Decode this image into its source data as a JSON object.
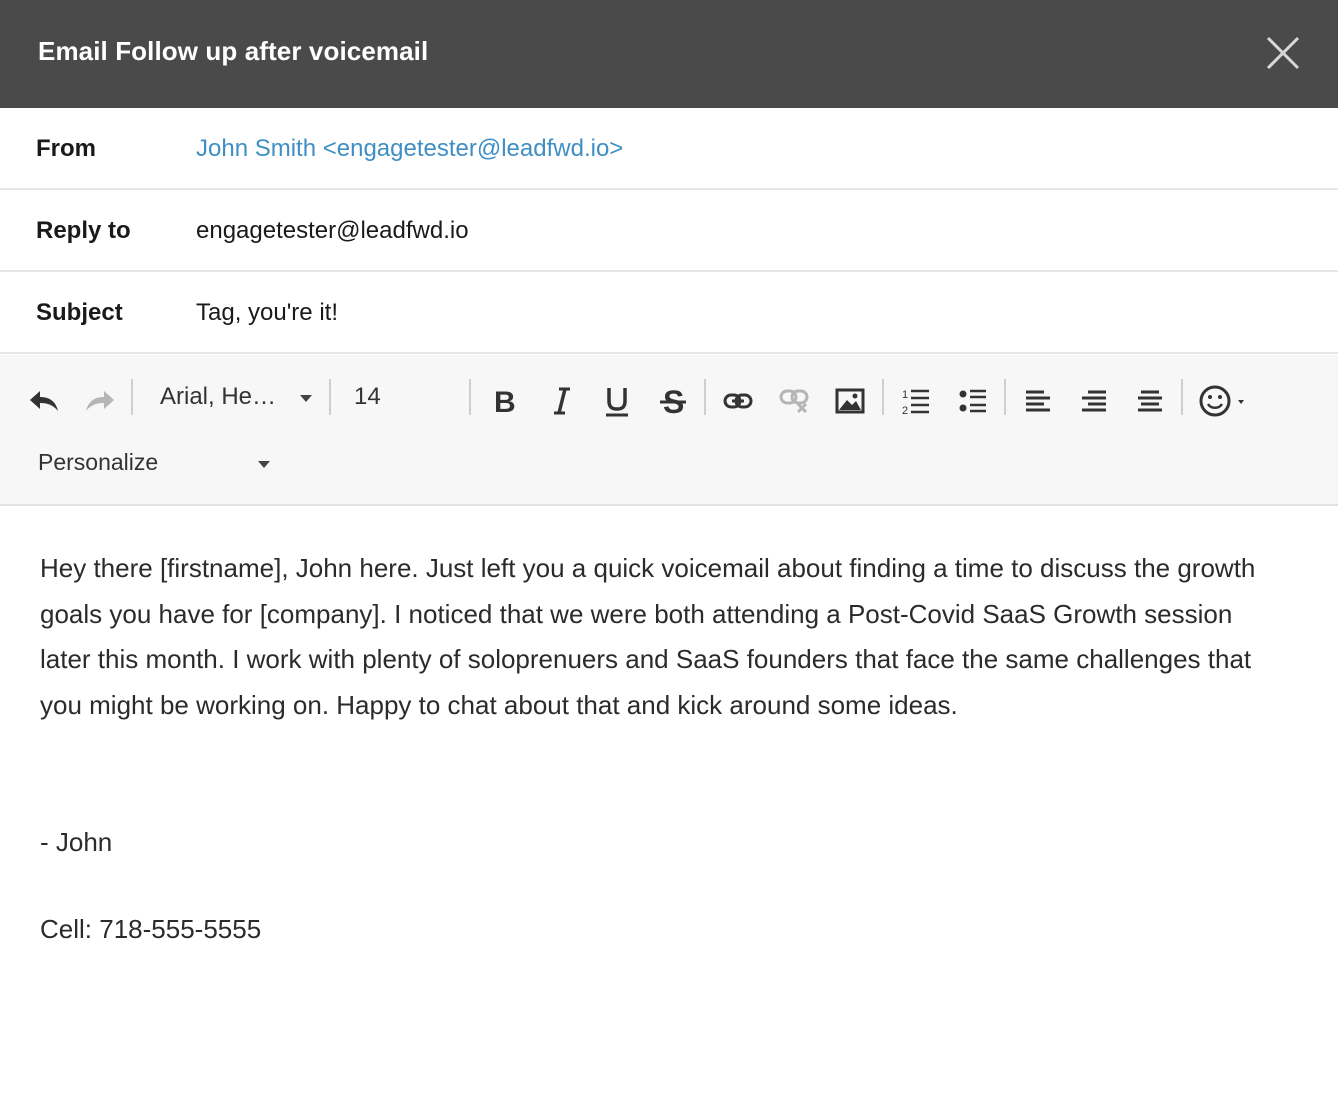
{
  "dialog": {
    "title": "Email Follow up after voicemail"
  },
  "fields": {
    "from_label": "From",
    "from_value": "John Smith <engagetester@leadfwd.io>",
    "reply_label": "Reply to",
    "reply_value": "engagetester@leadfwd.io",
    "subject_label": "Subject",
    "subject_value": "Tag, you're it!"
  },
  "toolbar": {
    "font_family": "Arial, He…",
    "font_size": "14",
    "personalize_label": "Personalize",
    "icons": [
      "undo-icon",
      "redo-icon",
      "bold-icon",
      "italic-icon",
      "underline-icon",
      "strikethrough-icon",
      "link-icon",
      "unlink-icon",
      "image-icon",
      "ordered-list-icon",
      "bullet-list-icon",
      "align-left-icon",
      "align-right-icon",
      "align-center-icon",
      "emoji-icon"
    ]
  },
  "body": {
    "paragraph1": "Hey there [firstname], John here. Just left you a quick voicemail about finding a time to discuss the growth goals you have for [company]. I noticed that we were both attending a Post-Covid SaaS Growth session later this month. I work with plenty of soloprenuers and SaaS founders that face the same challenges that you might be working on. Happy to chat about that and kick around some ideas.",
    "signature": "- John",
    "cell": "Cell: 718-555-5555"
  },
  "colors": {
    "titlebar": "#4a4a4a",
    "link": "#3f8fc4",
    "toolbar_bg": "#f7f7f7"
  }
}
